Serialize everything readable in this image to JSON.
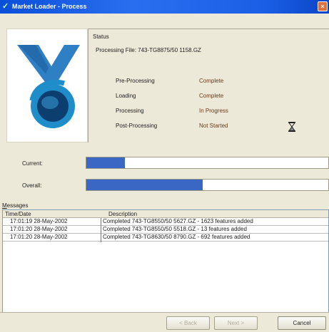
{
  "window": {
    "title": "Market Loader - Process",
    "close_glyph": "×"
  },
  "status": {
    "label": "Status",
    "processing_file": "Processing File: 743-TG8875/50 1158.GZ",
    "stages": [
      {
        "name": "Pre-Processing",
        "state": "Complete"
      },
      {
        "name": "Loading",
        "state": "Complete"
      },
      {
        "name": "Processing",
        "state": "In Progress"
      },
      {
        "name": "Post-Processing",
        "state": "Not Started"
      }
    ]
  },
  "progress": {
    "current_label": "Current:",
    "overall_label": "Overall:",
    "current_fraction": 0.16,
    "overall_fraction": 0.48
  },
  "messages": {
    "label_first": "M",
    "label_rest": "essages",
    "columns": [
      "Time/Date",
      "Description"
    ],
    "rows": [
      {
        "time": "17:01:19 28-May-2002",
        "description": "Completed 743-TG8550/50 5627.GZ - 1623 features added"
      },
      {
        "time": "17:01:20 28-May-2002",
        "description": "Completed 743-TG8550/50 5518.GZ - 13 features added"
      },
      {
        "time": "17:01:20 28-May-2002",
        "description": "Completed 743-TG8630/50 8790.GZ - 692 features added"
      }
    ]
  },
  "buttons": {
    "back": "< Back",
    "next": "Next >",
    "cancel": "Cancel"
  },
  "colors": {
    "titlebar": "#1b5fe6",
    "progress_fill": "#3b67c4",
    "stage_state_text": "#6b3a1a",
    "logo_blue": "#1f8dc9",
    "logo_dark": "#0c3f70"
  },
  "icons": {
    "app": "app-icon",
    "close": "close-icon",
    "logo": "globe-logo-icon",
    "busy": "hourglass-icon"
  }
}
